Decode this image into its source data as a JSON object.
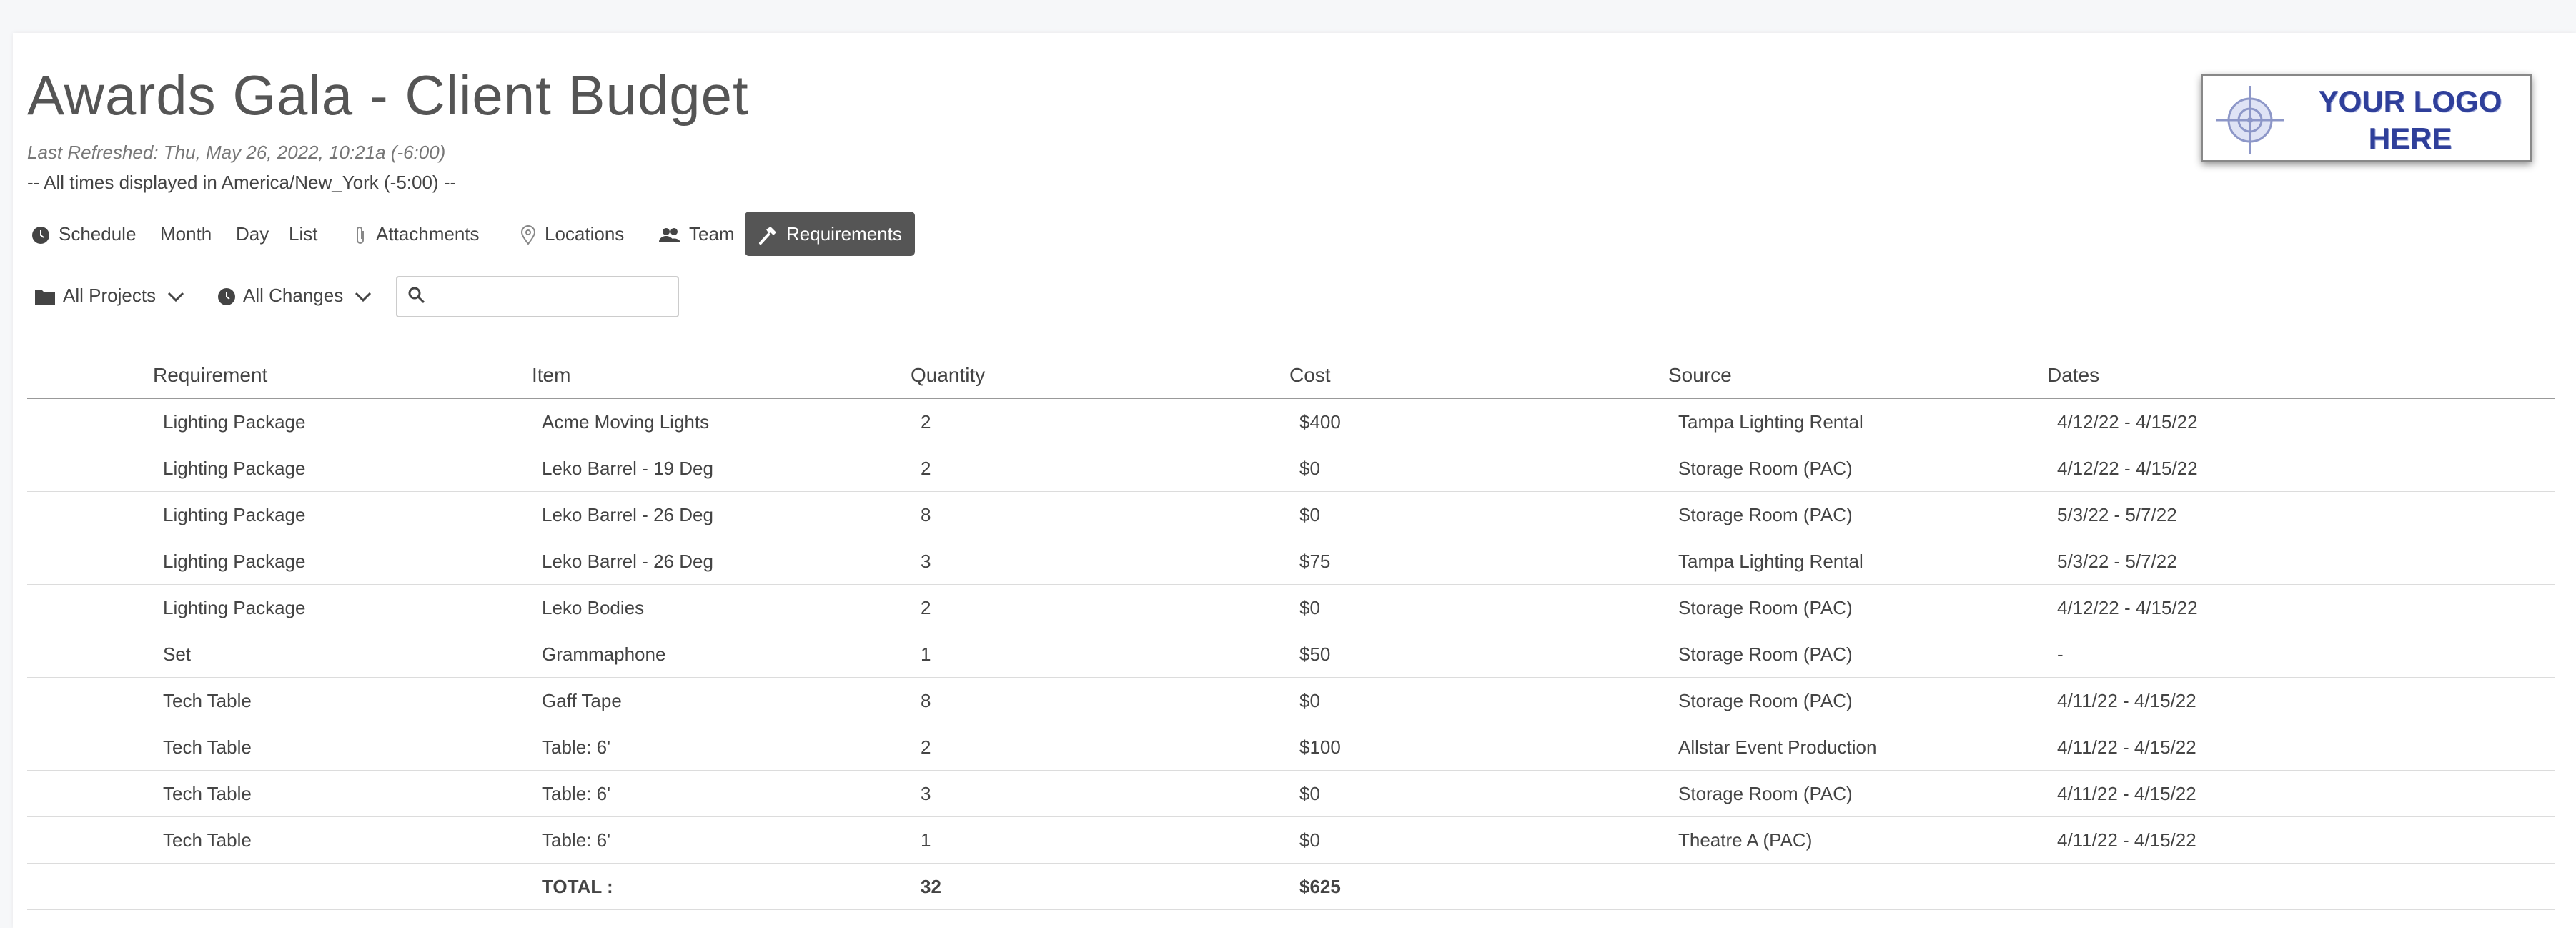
{
  "page": {
    "title": "Awards Gala - Client Budget",
    "last_refreshed": "Last Refreshed: Thu, May 26, 2022, 10:21a (-6:00)",
    "timezone_note": "-- All times displayed in America/New_York (-5:00) --",
    "logo_text": "YOUR LOGO HERE"
  },
  "nav": {
    "schedule": "Schedule",
    "month": "Month",
    "day": "Day",
    "list": "List",
    "attachments": "Attachments",
    "locations": "Locations",
    "team": "Team",
    "requirements": "Requirements"
  },
  "filters": {
    "projects": "All Projects",
    "changes": "All Changes",
    "search_value": ""
  },
  "table": {
    "headers": {
      "requirement": "Requirement",
      "item": "Item",
      "quantity": "Quantity",
      "cost": "Cost",
      "source": "Source",
      "dates": "Dates"
    },
    "rows": [
      {
        "requirement": "Lighting Package",
        "item": "Acme Moving Lights",
        "quantity": "2",
        "cost": "$400",
        "source": "Tampa Lighting Rental",
        "dates": "4/12/22 - 4/15/22"
      },
      {
        "requirement": "Lighting Package",
        "item": "Leko Barrel - 19 Deg",
        "quantity": "2",
        "cost": "$0",
        "source": "Storage Room (PAC)",
        "dates": "4/12/22 - 4/15/22"
      },
      {
        "requirement": "Lighting Package",
        "item": "Leko Barrel - 26 Deg",
        "quantity": "8",
        "cost": "$0",
        "source": "Storage Room (PAC)",
        "dates": "5/3/22 - 5/7/22"
      },
      {
        "requirement": "Lighting Package",
        "item": "Leko Barrel - 26 Deg",
        "quantity": "3",
        "cost": "$75",
        "source": "Tampa Lighting Rental",
        "dates": "5/3/22 - 5/7/22"
      },
      {
        "requirement": "Lighting Package",
        "item": "Leko Bodies",
        "quantity": "2",
        "cost": "$0",
        "source": "Storage Room (PAC)",
        "dates": "4/12/22 - 4/15/22"
      },
      {
        "requirement": "Set",
        "item": "Grammaphone",
        "quantity": "1",
        "cost": "$50",
        "source": "Storage Room (PAC)",
        "dates": "-"
      },
      {
        "requirement": "Tech Table",
        "item": "Gaff Tape",
        "quantity": "8",
        "cost": "$0",
        "source": "Storage Room (PAC)",
        "dates": "4/11/22 - 4/15/22"
      },
      {
        "requirement": "Tech Table",
        "item": "Table: 6'",
        "quantity": "2",
        "cost": "$100",
        "source": "Allstar Event Production",
        "dates": "4/11/22 - 4/15/22"
      },
      {
        "requirement": "Tech Table",
        "item": "Table: 6'",
        "quantity": "3",
        "cost": "$0",
        "source": "Storage Room (PAC)",
        "dates": "4/11/22 - 4/15/22"
      },
      {
        "requirement": "Tech Table",
        "item": "Table: 6'",
        "quantity": "1",
        "cost": "$0",
        "source": "Theatre A (PAC)",
        "dates": "4/11/22 - 4/15/22"
      }
    ],
    "total": {
      "label": "TOTAL :",
      "quantity": "32",
      "cost": "$625"
    }
  },
  "icons": {
    "schedule": "clock-icon",
    "attachments": "paperclip-icon",
    "locations": "map-pin-icon",
    "team": "people-icon",
    "requirements": "hammer-icon",
    "projects": "folder-icon",
    "changes": "history-icon",
    "search": "search-icon"
  },
  "colors": {
    "active_tab_bg": "#555555",
    "logo_text": "#2f3f9a"
  }
}
